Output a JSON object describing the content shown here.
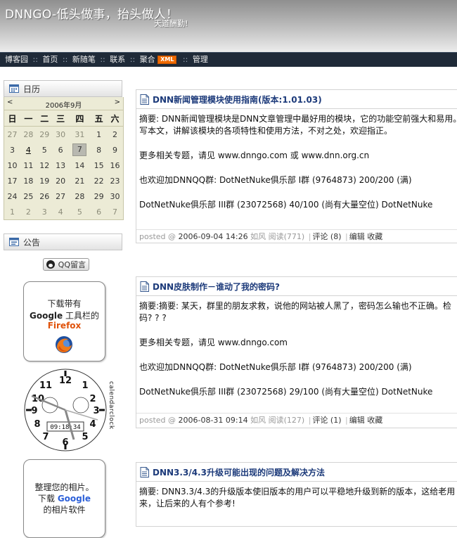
{
  "header": {
    "title": "DNNGO-低头做事，抬头做人！",
    "subtitle": "天道酬勤!"
  },
  "nav": {
    "items": [
      "博客园",
      "首页",
      "新随笔",
      "联系",
      "聚合",
      "管理"
    ],
    "separator": "::",
    "xml_badge": "XML"
  },
  "sidebar": {
    "calendar": {
      "heading": "日历",
      "month_label": "2006年9月",
      "prev": "<",
      "next": ">",
      "weekdays": [
        "日",
        "一",
        "二",
        "三",
        "四",
        "五",
        "六"
      ],
      "weeks": [
        [
          "27",
          "28",
          "29",
          "30",
          "31",
          "1",
          "2"
        ],
        [
          "3",
          "4",
          "5",
          "6",
          "7",
          "8",
          "9"
        ],
        [
          "10",
          "11",
          "12",
          "13",
          "14",
          "15",
          "16"
        ],
        [
          "17",
          "18",
          "19",
          "20",
          "21",
          "22",
          "23"
        ],
        [
          "24",
          "25",
          "26",
          "27",
          "28",
          "29",
          "30"
        ],
        [
          "1",
          "2",
          "3",
          "4",
          "5",
          "6",
          "7"
        ]
      ],
      "today": "7",
      "linked_day": "4"
    },
    "notice": {
      "heading": "公告",
      "qq_button": "QQ留言",
      "firefox_card": {
        "line1": "下载带有",
        "google": "Google",
        "toolbar": " 工具栏的",
        "firefox": "Firefox"
      },
      "clock": {
        "time": "09:18:34",
        "side_label": "calendarclock"
      },
      "photo_card": {
        "line1": "整理您的相片。",
        "line2_prefix": "下载 ",
        "google": "Google",
        "line3": "的相片软件"
      }
    }
  },
  "posts": [
    {
      "title": "DNN新闻管理模块使用指南(版本:1.01.03)",
      "summary": "摘要: DNN新闻管理模块是DNN文章管理中最好用的模块，它的功能空前强大和易用。",
      "summary2": "写本文，讲解该模块的各项特性和使用方法，不对之处，欢迎指正。",
      "more": "更多相关专题，请见  www.dnngo.com 或  www.dnn.org.cn",
      "qq1": "也欢迎加DNNQQ群:     DotNetNuke俱乐部 I群 (9764873)     200/200 (满)",
      "qq2": "DotNetNuke俱乐部 III群 (23072568)     40/100 (尚有大量空位)     DotNetNuke",
      "footer": {
        "posted": "posted @ ",
        "date": "2006-09-04 14:26",
        "author": " 如风 ",
        "reads": "阅读(771)",
        "comments": "评论 (8)",
        "edit": "编辑",
        "fav": "收藏"
      }
    },
    {
      "title": "DNN皮肤制作－谁动了我的密码?",
      "summary": "摘要:摘要: 某天，群里的朋友求救，说他的网站被人黑了，密码怎么输也不正确。检",
      "summary2": "码? ? ?",
      "more": "更多相关专题，请见  www.dnngo.com",
      "qq1": "也欢迎加DNNQQ群:     DotNetNuke俱乐部 I群 (9764873)     200/200 (满)",
      "qq2": "DotNetNuke俱乐部 III群 (23072568)     29/100 (尚有大量空位)     DotNetNuke",
      "footer": {
        "posted": "posted @ ",
        "date": "2006-08-31 09:14",
        "author": " 如风 ",
        "reads": "阅读(127)",
        "comments": "评论 (1)",
        "edit": "编辑",
        "fav": "收藏"
      }
    },
    {
      "title": "DNN3.3/4.3升级可能出现的问题及解决方法",
      "summary": "摘要: DNN3.3/4.3的升级版本使旧版本的用户可以平稳地升级到新的版本，这给老用",
      "summary2": "来，让后来的人有个参考!"
    }
  ],
  "colors": {
    "nav_bg": "#1f2a38",
    "title_link": "#1c3a7a",
    "xml_badge": "#f06a00",
    "calendar_bg": "#ecebd6"
  }
}
